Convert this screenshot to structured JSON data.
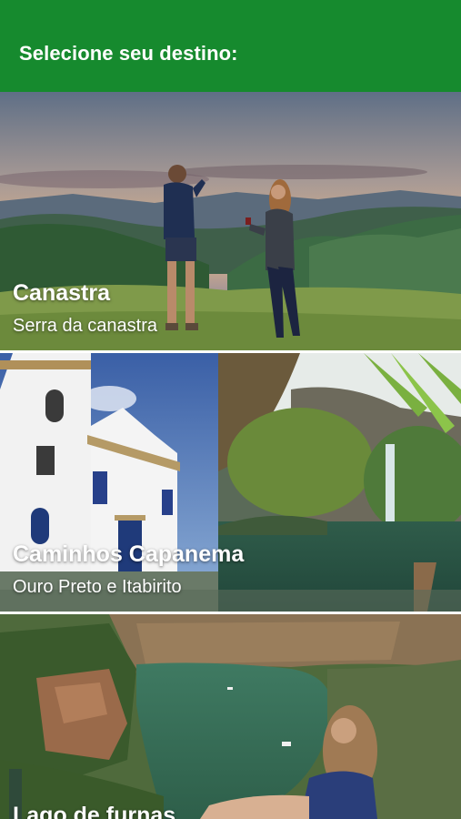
{
  "header": {
    "title": "Selecione seu destino:"
  },
  "destinations": [
    {
      "title": "Canastra",
      "subtitle": "Serra da canastra"
    },
    {
      "title": "Caminhos Capanema",
      "subtitle": "Ouro Preto e Itabirito"
    },
    {
      "title": "Lago de furnas",
      "subtitle": ""
    }
  ],
  "colors": {
    "header_bg": "#168a2e",
    "text_on_image": "#ffffff"
  }
}
